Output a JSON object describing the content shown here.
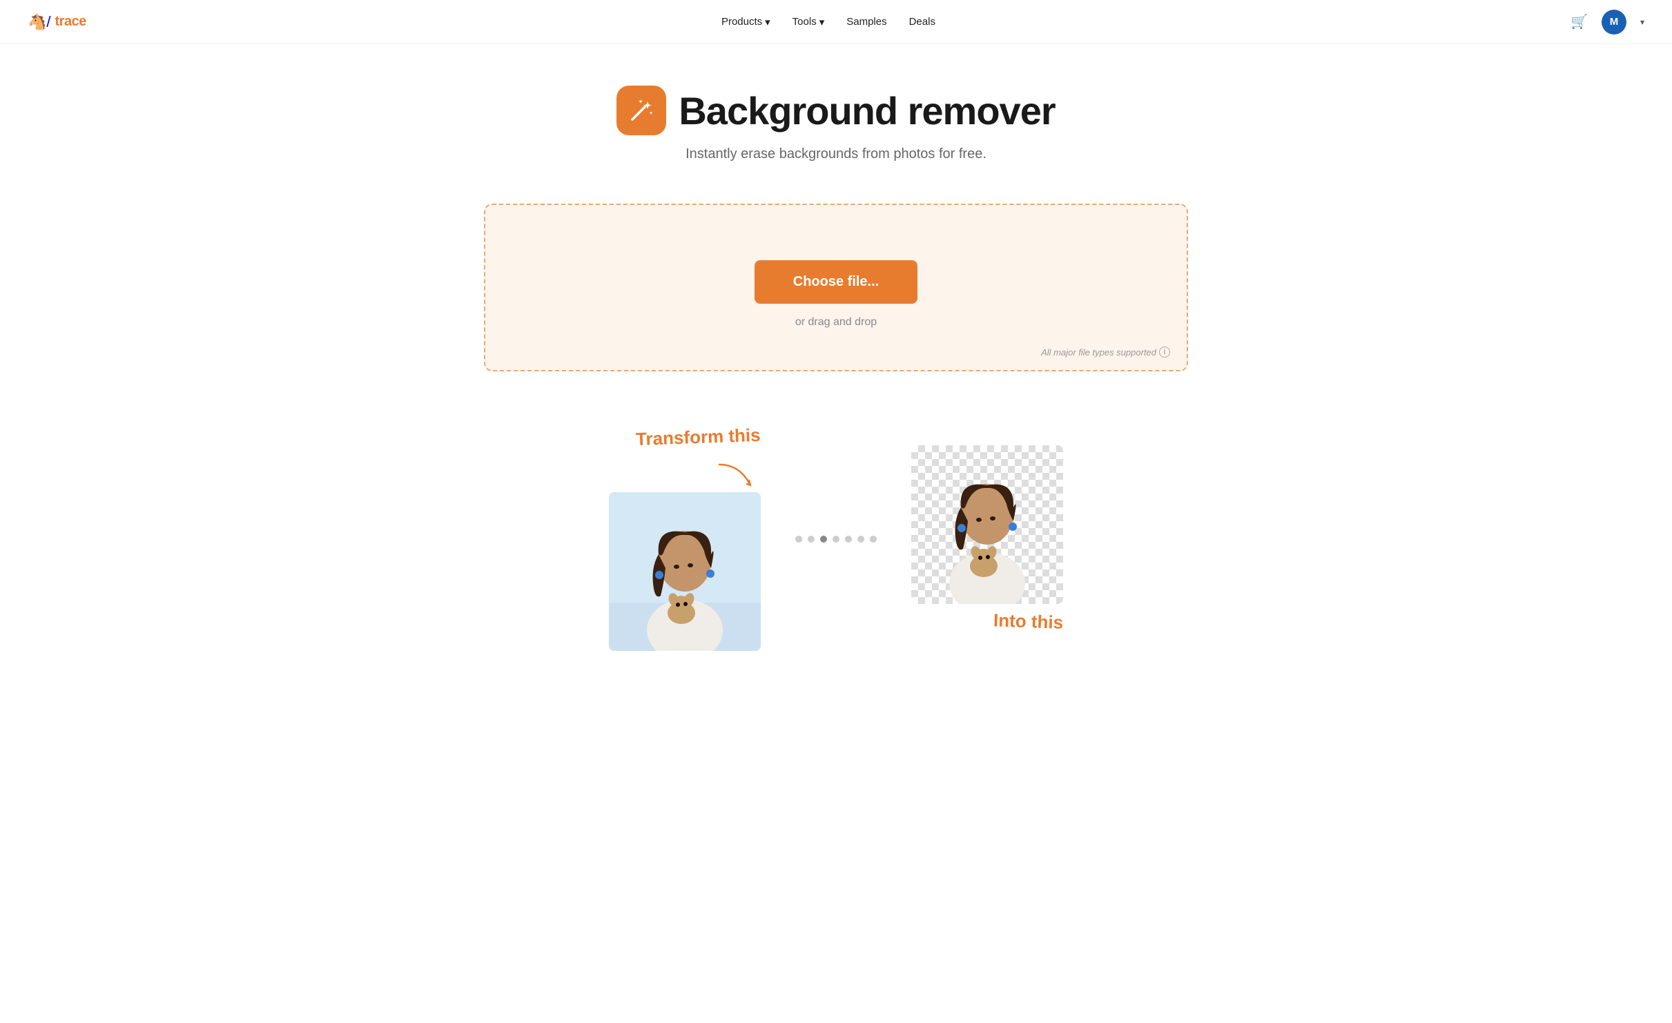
{
  "nav": {
    "logo_horse": "🐴",
    "logo_text": "trace",
    "links": [
      {
        "label": "Products",
        "has_caret": true,
        "id": "products"
      },
      {
        "label": "Tools",
        "has_caret": true,
        "id": "tools"
      },
      {
        "label": "Samples",
        "has_caret": false,
        "id": "samples"
      },
      {
        "label": "Deals",
        "has_caret": false,
        "id": "deals"
      }
    ],
    "cart_icon": "🛒",
    "avatar_initial": "M"
  },
  "hero": {
    "title": "Background remover",
    "subtitle": "Instantly erase backgrounds from photos for free."
  },
  "upload": {
    "choose_label": "Choose file...",
    "drag_label": "or drag and drop",
    "file_types_label": "All major file types supported"
  },
  "demo": {
    "transform_label": "Transform this",
    "into_label": "Into this",
    "dots": [
      {
        "active": false
      },
      {
        "active": false
      },
      {
        "active": true
      },
      {
        "active": false
      },
      {
        "active": false
      },
      {
        "active": false
      },
      {
        "active": false
      }
    ]
  }
}
